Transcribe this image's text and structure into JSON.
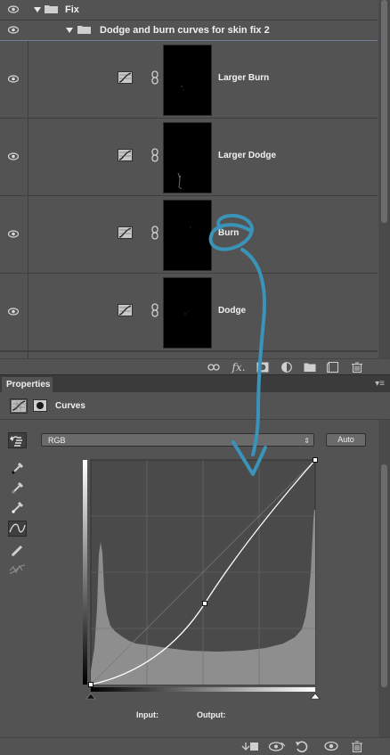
{
  "layers_panel": {
    "groups": [
      {
        "name": "Fix"
      },
      {
        "name": "Dodge and burn curves for skin fix 2"
      }
    ],
    "layers": [
      {
        "name": "Larger Burn"
      },
      {
        "name": "Larger Dodge"
      },
      {
        "name": "Burn",
        "annotated": true
      },
      {
        "name": "Dodge"
      }
    ],
    "footer_icons": [
      "link-icon",
      "fx-icon",
      "add-mask-icon",
      "adjustment-layer-icon",
      "new-group-icon",
      "new-layer-icon",
      "trash-icon"
    ]
  },
  "properties_panel": {
    "tab_label": "Properties",
    "title": "Curves",
    "preset_channel": "RGB",
    "auto_label": "Auto",
    "input_label": "Input:",
    "output_label": "Output:",
    "tools": [
      "on-image-adjust-icon",
      "black-point-eyedropper-icon",
      "gray-point-eyedropper-icon",
      "white-point-eyedropper-icon",
      "curve-points-icon",
      "pencil-icon",
      "smooth-icon"
    ],
    "footer_icons": [
      "clip-to-layer-icon",
      "view-previous-icon",
      "reset-icon",
      "visibility-icon",
      "trash-icon"
    ]
  },
  "annotation": {
    "color": "#3a93b8"
  },
  "colors": {
    "panel_bg": "#535353",
    "dark_bar": "#3b3b3b",
    "graph_bg": "#4a4a4a",
    "histogram": "#8e8e8e"
  }
}
